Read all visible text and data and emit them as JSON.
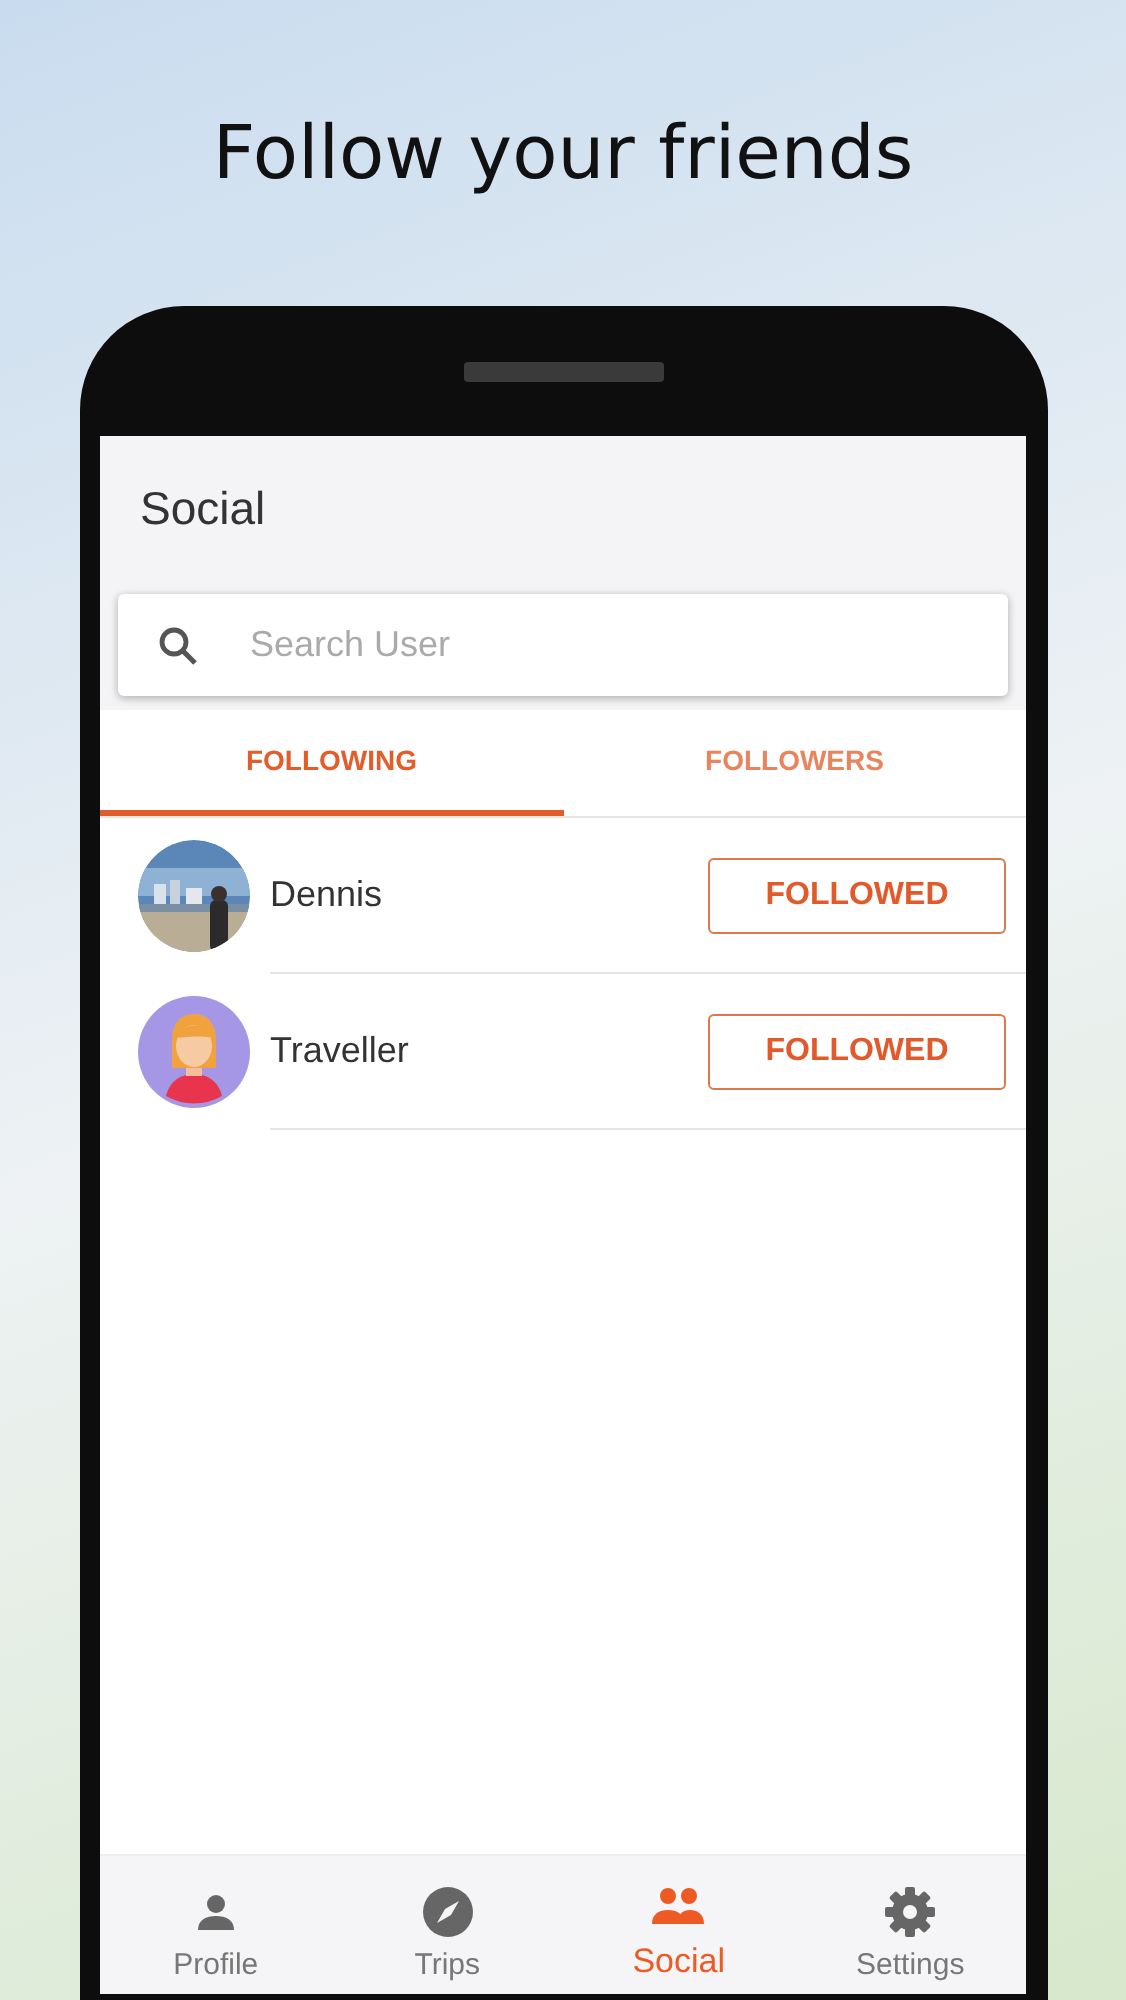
{
  "headline": "Follow your friends",
  "screen": {
    "title": "Social",
    "search": {
      "placeholder": "Search User"
    },
    "tabs": [
      {
        "label": "FOLLOWING",
        "selected": true
      },
      {
        "label": "FOLLOWERS",
        "selected": false
      }
    ],
    "users": [
      {
        "name": "Dennis",
        "button": "FOLLOWED"
      },
      {
        "name": "Traveller",
        "kind": "figure",
        "button": "FOLLOWED"
      }
    ],
    "nav": [
      {
        "label": "Profile",
        "selected": false
      },
      {
        "label": "Trips",
        "selected": false
      },
      {
        "label": "Social",
        "selected": true
      },
      {
        "label": "Settings",
        "selected": false
      }
    ]
  }
}
